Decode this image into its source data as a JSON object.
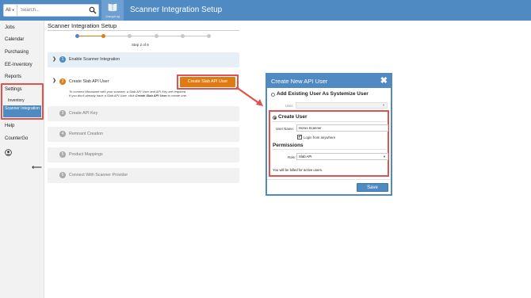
{
  "topbar": {
    "search_scope": "All",
    "search_placeholder": "Search...",
    "changelog_label": "ChangeLog",
    "page_heading": "Scanner Integration Setup"
  },
  "sidebar": {
    "items": [
      {
        "label": "Jobs"
      },
      {
        "label": "Calendar"
      },
      {
        "label": "Purchasing"
      },
      {
        "label": "EE-Inventory"
      },
      {
        "label": "Reports"
      },
      {
        "label": "Settings"
      },
      {
        "label": "Help"
      },
      {
        "label": "CounterGo"
      }
    ],
    "subitems": [
      {
        "label": "Inventory"
      },
      {
        "label": "Scanner Integration"
      }
    ]
  },
  "main": {
    "title": "Scanner Integration Setup",
    "stepper": {
      "total": 6,
      "current": 2,
      "caption": "Step 2 of 6"
    },
    "steps": [
      {
        "num": "1",
        "label": "Enable Scanner Integration"
      },
      {
        "num": "2",
        "label": "Create Slab API User"
      },
      {
        "num": "3",
        "label": "Create API Key"
      },
      {
        "num": "4",
        "label": "Remnant Creation"
      },
      {
        "num": "5",
        "label": "Product Mappings"
      },
      {
        "num": "6",
        "label": "Connect With Scanner Provider"
      }
    ],
    "create_button": "Create Slab API User",
    "help_line1": "To connect Moraware with your scanner, a Slab API User and API Key are required.",
    "help_line2_prefix": "If you don't already have a Slab API User, click ",
    "help_line2_bold": "Create Slab API User",
    "help_line2_suffix": " to create one."
  },
  "modal": {
    "title": "Create New API User",
    "close_glyph": "✖",
    "option_existing": "Add Existing User As Systemize User",
    "user_label": "User:",
    "option_create": "Create User",
    "username_label": "User Name:",
    "username_value": "Horus Scanner",
    "login_label": "Login from anywhere",
    "login_checked": true,
    "permissions_heading": "Permissions",
    "role_label": "Role:",
    "role_value": "Slab API",
    "billing_note": "You will be billed for active users.",
    "save_label": "Save"
  },
  "colors": {
    "brand_blue": "#4f8ac3",
    "accent_orange": "#e07a13",
    "highlight_red": "#e0524e"
  }
}
